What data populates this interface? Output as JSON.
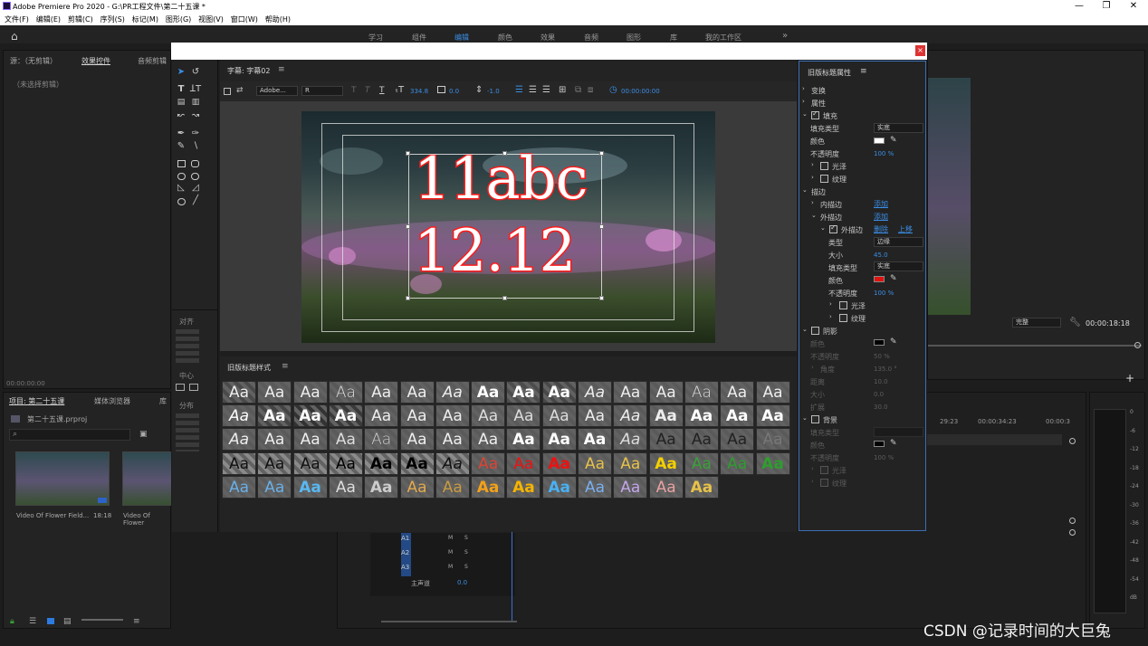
{
  "window": {
    "title": "Adobe Premiere Pro 2020 - G:\\PR工程文件\\第二十五课 *",
    "controls": [
      "—",
      "❐",
      "✕"
    ]
  },
  "menu": [
    "文件(F)",
    "编辑(E)",
    "剪辑(C)",
    "序列(S)",
    "标记(M)",
    "图形(G)",
    "视图(V)",
    "窗口(W)",
    "帮助(H)"
  ],
  "workspaces": {
    "items": [
      "学习",
      "组件",
      "编辑",
      "颜色",
      "效果",
      "音频",
      "图形",
      "库",
      "我的工作区"
    ],
    "active": "编辑",
    "more": "»"
  },
  "left_top_panel": {
    "tabs": [
      "源：（无剪辑）",
      "效果控件",
      "音频剪辑"
    ],
    "empty_text": "（未选择剪辑）",
    "timecode": "00:00:00:00"
  },
  "project_panel": {
    "tabs": [
      "项目: 第二十五课",
      "媒体浏览器",
      "库"
    ],
    "file": "第二十五课.prproj",
    "items": [
      {
        "name": "Video Of Flower Field...",
        "duration": "18:18"
      },
      {
        "name": "Video Of Flower"
      }
    ]
  },
  "program_monitor": {
    "zoom": "完整",
    "timecode": "00:00:18:18"
  },
  "timeline": {
    "ruler": [
      "29:23",
      "00:00:34:23",
      "00:00:3"
    ],
    "tracks": [
      {
        "name": "A1"
      },
      {
        "name": "A2"
      },
      {
        "name": "A3"
      }
    ],
    "master": {
      "label": "主声道",
      "value": "0.0"
    },
    "track_buttons": [
      "M",
      "S"
    ]
  },
  "audio_meter": {
    "ticks": [
      "0",
      "-6",
      "-12",
      "-18",
      "-24",
      "-30",
      "-36",
      "-42",
      "-48",
      "-54",
      "dB"
    ]
  },
  "title_dialog": {
    "close_symbol": "×",
    "tab": "字幕: 字幕02",
    "toolbar": {
      "font": "Adobe...",
      "style": "R",
      "size": "334.8",
      "tracking": "0.0",
      "leading": "-1.0",
      "timecode": "00:00:00:00"
    },
    "canvas_text": [
      "11abc",
      "12.12"
    ],
    "align_heading": "对齐",
    "center_heading": "中心",
    "distribute_heading": "分布",
    "styles_panel_title": "旧版标题样式",
    "styles_sample": "Aa"
  },
  "properties": {
    "title": "旧版标题属性",
    "transform": "变换",
    "attributes": "属性",
    "fill": {
      "label": "填充",
      "checked": true,
      "fill_type_label": "填充类型",
      "fill_type": "实底",
      "color_label": "颜色",
      "color": "#ffffff",
      "opacity_label": "不透明度",
      "opacity": "100 %",
      "sheen": "光泽",
      "texture": "纹理"
    },
    "strokes": {
      "label": "描边",
      "inner": {
        "label": "内描边",
        "action": "添加"
      },
      "outer": {
        "label": "外描边",
        "action": "添加"
      },
      "outer_item": {
        "label": "外描边",
        "checked": true,
        "delete": "删除",
        "move_up": "上移",
        "type_label": "类型",
        "type": "边缘",
        "size_label": "大小",
        "size": "45.0",
        "fill_type_label": "填充类型",
        "fill_type": "实底",
        "color_label": "颜色",
        "color": "#e0120e",
        "opacity_label": "不透明度",
        "opacity": "100 %",
        "sheen": "光泽",
        "texture": "纹理"
      }
    },
    "shadow": {
      "label": "阴影",
      "checked": false,
      "color_label": "颜色",
      "opacity_label": "不透明度",
      "opacity": "50 %",
      "angle_label": "角度",
      "angle": "135.0 °",
      "distance_label": "距离",
      "distance": "10.0",
      "size_label": "大小",
      "size": "0.0",
      "spread_label": "扩展",
      "spread": "30.0"
    },
    "background": {
      "label": "背景",
      "checked": false,
      "fill_type_label": "填充类型",
      "color_label": "颜色",
      "opacity_label": "不透明度",
      "opacity": "100 %",
      "sheen": "光泽",
      "texture": "纹理"
    }
  },
  "watermark": "CSDN @记录时间的大巨兔",
  "colors": {
    "accent": "#3a8ee6",
    "stroke_red": "#ff1a1a",
    "props_border": "#3b6fb6"
  }
}
